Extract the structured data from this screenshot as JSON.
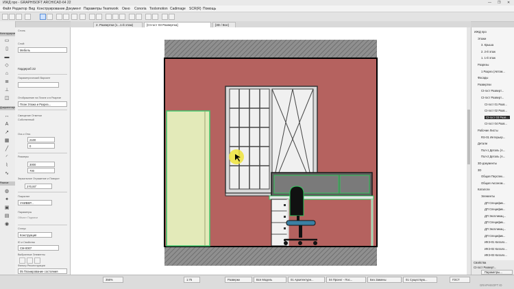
{
  "window": {
    "title": "ИЖД про - GRAPHISOFT ARCHICAD-64 22",
    "controls": [
      "—",
      "❐",
      "✕"
    ]
  },
  "menu": [
    "Файл",
    "Редактор",
    "Вид",
    "Конструирование",
    "Документ",
    "Параметры",
    "Teamwork",
    "Окно",
    "Conoria",
    "Toolsmotion",
    "Cadimage",
    "SCR(R)",
    "Помощь"
  ],
  "tabs": [
    {
      "label": "2. Развертки (1...1-й этаж)"
    },
    {
      "label": "[Сt-гост 03 Развертка]"
    },
    {
      "label": "[3D / Все]"
    }
  ],
  "toolbox": {
    "sections": [
      "Конструирование",
      "Документирование",
      "Разное"
    ]
  },
  "infobox": {
    "header": "Стиль",
    "labels": {
      "layer": "Слой:",
      "layer_value": "Мебель",
      "object_name": "Гардероб 22",
      "parametric": "Параметрический Вариант",
      "display_label": "Отображение на Плане и в Разрезе",
      "display_value": "План Этажа и Разрез...",
      "elevation_label": "Смещение Отметки",
      "elevation_hint": "Собственный",
      "size_label": "Ось к Отм.",
      "width": "2100",
      "depth": "0",
      "params_label": "Размеры",
      "dim1": "3000",
      "dim2": "700",
      "angle_label": "Зеркальное Отражение и Поворот",
      "angle": "270,00°",
      "cover_label": "Покрытие",
      "cover_value": "УНИВЕР...",
      "renovation_label": "Параметры",
      "renovation_value": "Объект Подписи",
      "status_label": "Статус",
      "status_value": "Конструкция",
      "id_label": "ID и Свойства",
      "id_value": "СМ-0007",
      "selected_label": "Выбранные Элементы",
      "filter_label": "Фильтр Реконструкции",
      "filter_value": "05 Планирование состояния"
    }
  },
  "drawing": {
    "colors": {
      "wall": "#b5625f",
      "hatch": "#8a8a8a",
      "cabinet": "#e3eab9",
      "selected_outline": "#3ec86d",
      "chair": "#3a7fa3",
      "desk_dark": "#6e6e6e"
    },
    "cursor_hint": "cursor"
  },
  "navigator": {
    "title": "ИЖД про",
    "items": [
      {
        "label": "ИЖД про",
        "indent": 0
      },
      {
        "label": "Этажи",
        "indent": 1
      },
      {
        "label": "3. Крыша",
        "indent": 2
      },
      {
        "label": "2. 2-й этаж",
        "indent": 2
      },
      {
        "label": "1. 1-й этаж",
        "indent": 2
      },
      {
        "label": "Разрезы",
        "indent": 1
      },
      {
        "label": "1 Разрез (Автом...",
        "indent": 2
      },
      {
        "label": "Фасады",
        "indent": 1
      },
      {
        "label": "Развертки",
        "indent": 1
      },
      {
        "label": "Сt-гост Разверт...",
        "indent": 2
      },
      {
        "label": "Сt-гост Разверт...",
        "indent": 2
      },
      {
        "label": "Сt-гост 01 Разв...",
        "indent": 3
      },
      {
        "label": "Сt-гост 02 Разв...",
        "indent": 3
      },
      {
        "label": "Сt-гост 03 Разв...",
        "indent": 3,
        "selected": true
      },
      {
        "label": "Сt-гост 04 Разв...",
        "indent": 3
      },
      {
        "label": "Рабочие Листы",
        "indent": 1
      },
      {
        "label": "RS-01 Интерьер...",
        "indent": 2
      },
      {
        "label": "Детали",
        "indent": 1
      },
      {
        "label": "Пол-1 Деталь (А...",
        "indent": 2
      },
      {
        "label": "Пол-2 Деталь (А...",
        "indent": 2
      },
      {
        "label": "3D-документы",
        "indent": 1
      },
      {
        "label": "3D",
        "indent": 1
      },
      {
        "label": "Общая Перспек...",
        "indent": 2
      },
      {
        "label": "Общая Аксоном...",
        "indent": 2
      },
      {
        "label": "Каталоги",
        "indent": 1
      },
      {
        "label": "Элементы",
        "indent": 2
      },
      {
        "label": "ДП Специфик...",
        "indent": 3
      },
      {
        "label": "ДП Специфик...",
        "indent": 3
      },
      {
        "label": "ДП Экспликац...",
        "indent": 3
      },
      {
        "label": "ДП Специфик...",
        "indent": 3
      },
      {
        "label": "ДП Экспликац...",
        "indent": 3
      },
      {
        "label": "ДП Специфик...",
        "indent": 3
      },
      {
        "label": "ИКЭ-01 Катало...",
        "indent": 3
      },
      {
        "label": "ИКЭ-02 Катало...",
        "indent": 3
      },
      {
        "label": "ИКЭ-03 Катало...",
        "indent": 3
      }
    ],
    "properties_label": "Свойства",
    "prop_row": "Сt-гост Разверт...",
    "params_button": "Параметры..."
  },
  "statusbar": {
    "zoom": "356%",
    "scale": "1:75",
    "pen_set": "Разверки",
    "model": "Вся Модель",
    "layer_combo": "01 Архитектурн...",
    "project": "04 Проект - Пос...",
    "override": "Без Замены",
    "renovation": "01 Существую...",
    "dimension": "ГОСТ",
    "brand": "GRAPHISOFT ID"
  }
}
